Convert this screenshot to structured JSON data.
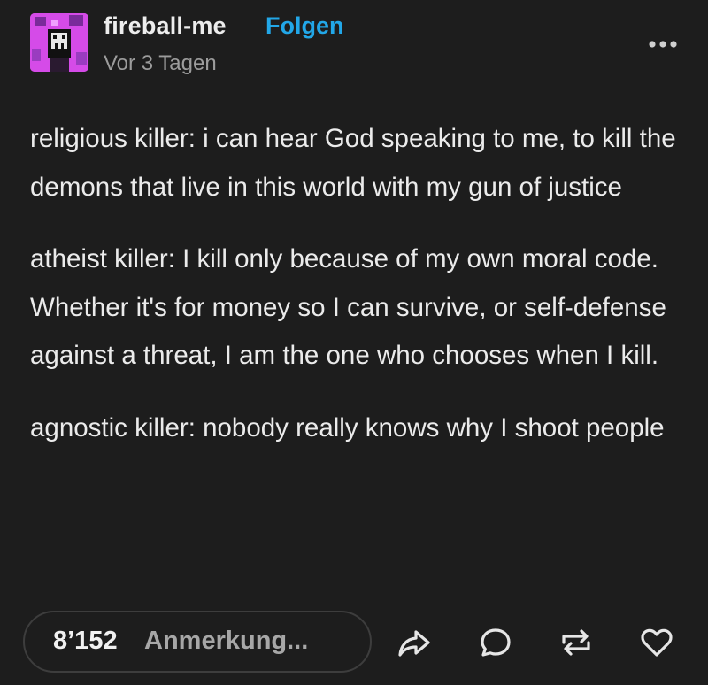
{
  "post": {
    "author": "fireball-me",
    "follow_label": "Folgen",
    "timestamp": "Vor 3 Tagen",
    "paragraphs": [
      "religious killer: i can hear God speaking to me, to kill the demons that live in this world with my gun of justice",
      "atheist killer: I kill only because of my own moral code. Whether it's for money so I can survive, or self-defense against a threat, I am the one who chooses when I kill.",
      "agnostic killer: nobody really knows why I shoot people"
    ]
  },
  "footer": {
    "notes_count": "8’152",
    "notes_label": "Anmerkung...",
    "actions": [
      "share-icon",
      "reply-icon",
      "reblog-icon",
      "like-icon"
    ]
  },
  "colors": {
    "background": "#1d1d1d",
    "text": "#ebebeb",
    "accent": "#22a7e8",
    "muted": "#9c9c9c",
    "avatar_bg": "#d54be8"
  }
}
